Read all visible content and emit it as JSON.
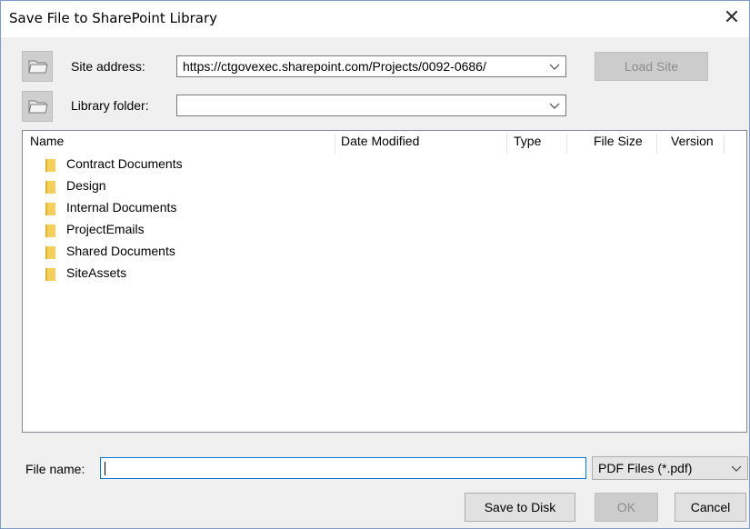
{
  "window": {
    "title": "Save File to SharePoint Library",
    "close_glyph": "✕"
  },
  "site": {
    "label": "Site address:",
    "value": "https://ctgovexec.sharepoint.com/Projects/0092-0686/",
    "load_button": "Load Site",
    "icon": "folder-open-icon"
  },
  "library": {
    "label": "Library folder:",
    "value": "",
    "icon": "folder-open-icon"
  },
  "list": {
    "columns": [
      "Name",
      "Date Modified",
      "Type",
      "File Size",
      "Version"
    ],
    "items": [
      {
        "name": "Contract Documents"
      },
      {
        "name": "Design"
      },
      {
        "name": "Internal Documents"
      },
      {
        "name": "ProjectEmails"
      },
      {
        "name": "Shared Documents"
      },
      {
        "name": "SiteAssets"
      }
    ]
  },
  "footer": {
    "file_name_label": "File name:",
    "file_name_value": "",
    "file_type": "PDF Files (*.pdf)",
    "save_to_disk": "Save to Disk",
    "ok": "OK",
    "cancel": "Cancel"
  },
  "colors": {
    "folder": "#f0c040",
    "border_accent": "#0078d7"
  }
}
